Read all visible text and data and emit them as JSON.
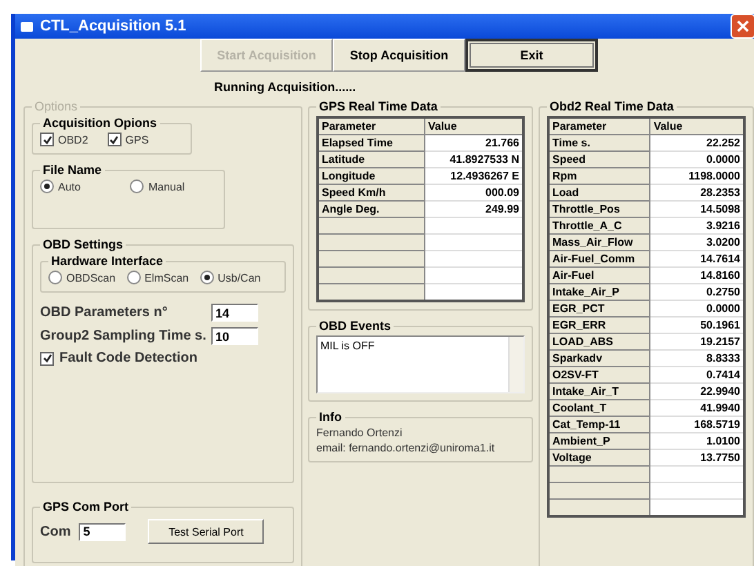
{
  "window": {
    "title": "CTL_Acquisition 5.1"
  },
  "toolbar": [
    {
      "label": "Start Acquisition",
      "disabled": true,
      "default": false
    },
    {
      "label": "Stop Acquisition",
      "disabled": false,
      "default": false
    },
    {
      "label": "Exit",
      "disabled": false,
      "default": true
    }
  ],
  "status": "Running Acquisition......",
  "options": {
    "title": "Options",
    "acquisition": {
      "title": "Acquisition Opions",
      "items": [
        {
          "label": "OBD2",
          "checked": true
        },
        {
          "label": "GPS",
          "checked": true
        }
      ]
    },
    "file_name": {
      "title": "File Name",
      "items": [
        {
          "label": "Auto",
          "selected": true
        },
        {
          "label": "Manual",
          "selected": false
        }
      ]
    },
    "obd_settings": {
      "title": "OBD Settings",
      "hardware": {
        "title": "Hardware Interface",
        "items": [
          {
            "label": "OBDScan",
            "selected": false
          },
          {
            "label": "ElmScan",
            "selected": false
          },
          {
            "label": "Usb/Can",
            "selected": true
          }
        ]
      },
      "fields": [
        {
          "label": "OBD Parameters n°",
          "value": "14"
        },
        {
          "label": "Group2 Sampling Time s.",
          "value": "10"
        }
      ],
      "fault_detection": {
        "label": "Fault Code Detection",
        "checked": true
      }
    },
    "gps_port": {
      "title": "GPS Com Port",
      "label": "Com",
      "value": "5",
      "button": "Test Serial Port"
    }
  },
  "gps": {
    "title": "GPS Real Time Data",
    "columns": [
      "Parameter",
      "Value"
    ],
    "rows": [
      [
        "Elapsed Time",
        "21.766"
      ],
      [
        "Latitude",
        "41.8927533 N"
      ],
      [
        "Longitude",
        "12.4936267 E"
      ],
      [
        "Speed Km/h",
        "000.09"
      ],
      [
        "Angle Deg.",
        "249.99"
      ]
    ]
  },
  "obd_events": {
    "title": "OBD Events",
    "lines": [
      "MIL is OFF"
    ]
  },
  "info": {
    "title": "Info",
    "lines": [
      "Fernando Ortenzi",
      "email: fernando.ortenzi@uniroma1.it"
    ]
  },
  "obd2": {
    "title": "Obd2 Real Time Data",
    "columns": [
      "Parameter",
      "Value"
    ],
    "rows": [
      [
        "Time s.",
        "22.252"
      ],
      [
        "Speed",
        "0.0000"
      ],
      [
        "Rpm",
        "1198.0000"
      ],
      [
        "Load",
        "28.2353"
      ],
      [
        "Throttle_Pos",
        "14.5098"
      ],
      [
        "Throttle_A_C",
        "3.9216"
      ],
      [
        "Mass_Air_Flow",
        "3.0200"
      ],
      [
        "Air-Fuel_Comm",
        "14.7614"
      ],
      [
        "Air-Fuel",
        "14.8160"
      ],
      [
        "Intake_Air_P",
        "0.2750"
      ],
      [
        "EGR_PCT",
        "0.0000"
      ],
      [
        "EGR_ERR",
        "50.1961"
      ],
      [
        "LOAD_ABS",
        "19.2157"
      ],
      [
        "Sparkadv",
        "8.8333"
      ],
      [
        "O2SV-FT",
        "0.7414"
      ],
      [
        "Intake_Air_T",
        "22.9940"
      ],
      [
        "Coolant_T",
        "41.9940"
      ],
      [
        "Cat_Temp-11",
        "168.5719"
      ],
      [
        "Ambient_P",
        "1.0100"
      ],
      [
        "Voltage",
        "13.7750"
      ]
    ]
  }
}
